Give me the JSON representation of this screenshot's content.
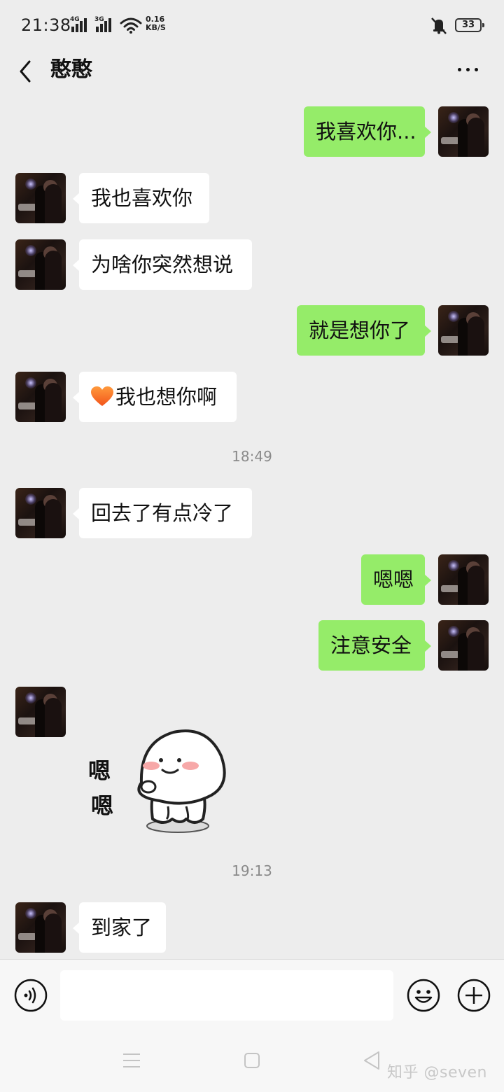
{
  "status_bar": {
    "time": "21:38",
    "network1": "4G",
    "network2": "3G",
    "speed_value": "0.16",
    "speed_unit": "KB/S",
    "battery": "33"
  },
  "header": {
    "title": "憨憨"
  },
  "messages": [
    {
      "side": "out",
      "text": "我喜欢你..."
    },
    {
      "side": "in",
      "text": "我也喜欢你"
    },
    {
      "side": "in",
      "text": "为啥你突然想说"
    },
    {
      "side": "out",
      "text": "就是想你了"
    },
    {
      "side": "in",
      "text": "我也想你啊",
      "emoji": "orange-heart"
    },
    {
      "type": "time",
      "text": "18:49"
    },
    {
      "side": "in",
      "text": "回去了有点冷了"
    },
    {
      "side": "out",
      "text": "嗯嗯"
    },
    {
      "side": "out",
      "text": "注意安全"
    },
    {
      "side": "in",
      "type": "sticker",
      "sticker_text": [
        "嗯",
        "嗯"
      ]
    },
    {
      "type": "time",
      "text": "19:13"
    },
    {
      "side": "in",
      "text": "到家了"
    }
  ],
  "input_bar": {
    "value": "",
    "icons": [
      "voice-icon",
      "emoji-icon",
      "plus-icon"
    ]
  },
  "watermark": "知乎 @seven",
  "colors": {
    "background": "#ededed",
    "bubble_out": "#95ec69",
    "bubble_in": "#ffffff"
  }
}
